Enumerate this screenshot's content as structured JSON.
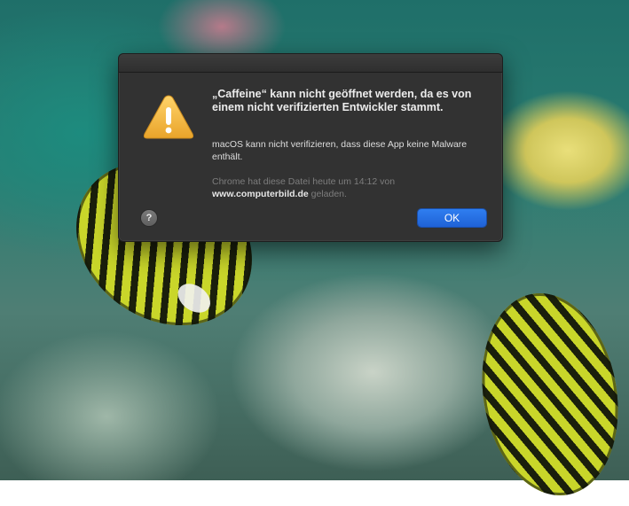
{
  "dialog": {
    "title": "„Caffeine“ kann nicht geöffnet werden, da es von einem nicht verifizierten Entwickler stammt.",
    "message": "macOS kann nicht verifizieren, dass diese App keine Malware enthält.",
    "info_prefix": "Chrome hat diese Datei heute um 14:12 von",
    "info_domain": "www.computerbild.de",
    "info_suffix": "geladen.",
    "help_label": "?",
    "ok_label": "OK",
    "icon": "warning-triangle-icon",
    "accent_color": "#2a74e8",
    "warning_color": "#f2b53a"
  }
}
